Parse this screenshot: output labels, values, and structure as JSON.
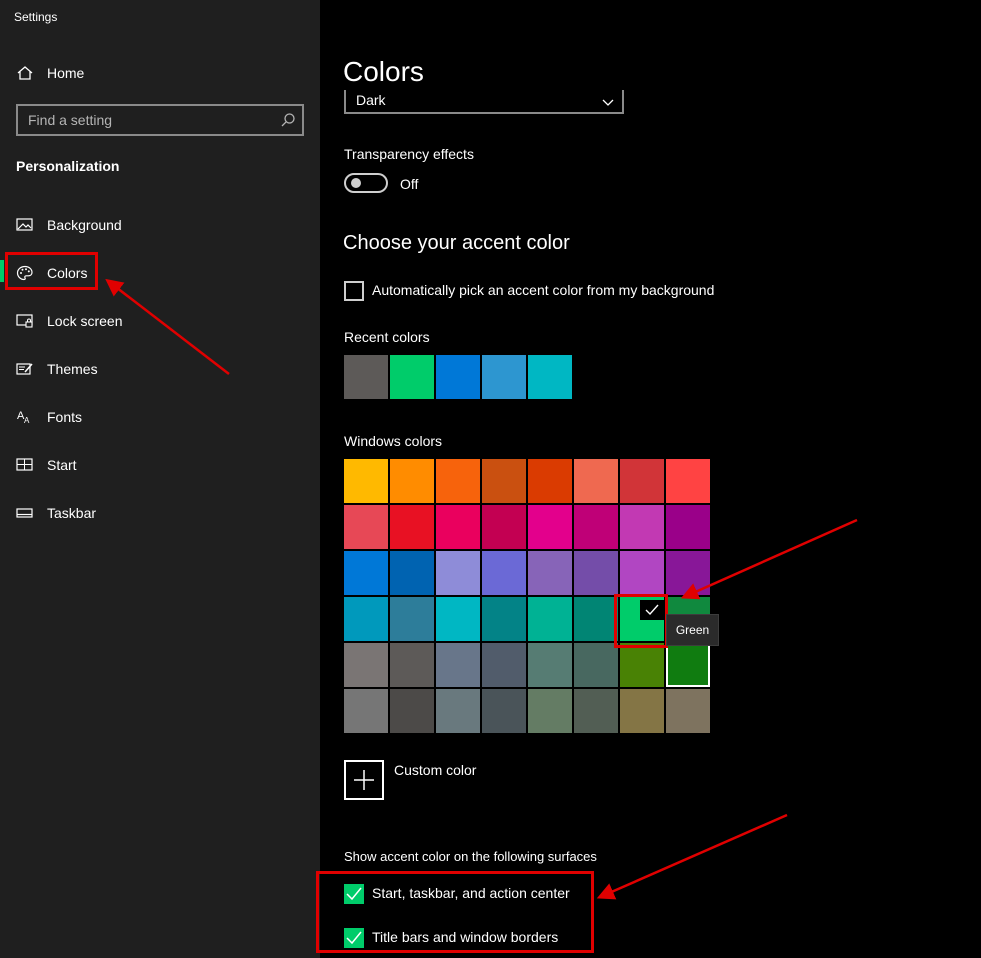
{
  "window": {
    "title": "Settings"
  },
  "sidebar": {
    "home_label": "Home",
    "search_placeholder": "Find a setting",
    "section": "Personalization",
    "items": [
      {
        "label": "Background",
        "icon": "image-icon"
      },
      {
        "label": "Colors",
        "icon": "palette-icon",
        "selected": true
      },
      {
        "label": "Lock screen",
        "icon": "lock-screen-icon"
      },
      {
        "label": "Themes",
        "icon": "themes-icon"
      },
      {
        "label": "Fonts",
        "icon": "fonts-icon"
      },
      {
        "label": "Start",
        "icon": "start-icon"
      },
      {
        "label": "Taskbar",
        "icon": "taskbar-icon"
      }
    ]
  },
  "main": {
    "title": "Colors",
    "mode_value": "Dark",
    "transparency": {
      "label": "Transparency effects",
      "state": "Off"
    },
    "accent_heading": "Choose your accent color",
    "auto_pick_label": "Automatically pick an accent color from my background",
    "recent_colors_label": "Recent colors",
    "recent_colors": [
      "#5d5a58",
      "#00cc6a",
      "#0078d7",
      "#2d96d0",
      "#00b7c3"
    ],
    "windows_colors_label": "Windows colors",
    "windows_colors": [
      [
        "#ffb900",
        "#ff8c00",
        "#f7630c",
        "#ca5010",
        "#da3b01",
        "#ef6950",
        "#d13438",
        "#ff4343"
      ],
      [
        "#e74856",
        "#e81123",
        "#ea005e",
        "#c30052",
        "#e3008c",
        "#bf0077",
        "#c239b3",
        "#9a0089"
      ],
      [
        "#0078d7",
        "#0063b1",
        "#8e8cd8",
        "#6b69d6",
        "#8764b8",
        "#744da9",
        "#b146c2",
        "#881798"
      ],
      [
        "#0099bc",
        "#2d7d9a",
        "#00b7c3",
        "#038387",
        "#00b294",
        "#018574",
        "#00cc6a",
        "#10893e"
      ],
      [
        "#7a7574",
        "#5d5a58",
        "#68768a",
        "#515c6b",
        "#567c73",
        "#486860",
        "#498205",
        "#107c10"
      ],
      [
        "#767676",
        "#4c4a48",
        "#69797e",
        "#4a5459",
        "#647c64",
        "#525e54",
        "#847545",
        "#7e735f"
      ]
    ],
    "selected_color_name": "Green",
    "custom_color_label": "Custom color",
    "surfaces_label": "Show accent color on the following surfaces",
    "surface_options": [
      {
        "label": "Start, taskbar, and action center",
        "checked": true
      },
      {
        "label": "Title bars and window borders",
        "checked": true
      }
    ]
  },
  "colors": {
    "accent": "#00cc6a",
    "annotation": "#e00000"
  }
}
